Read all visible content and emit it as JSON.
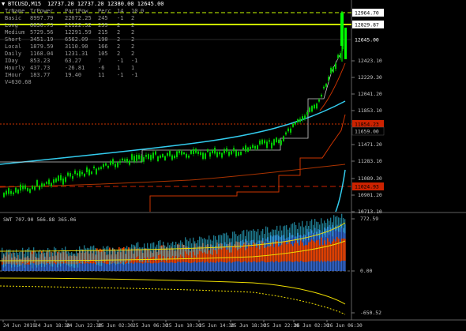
{
  "header": {
    "symbol": "BTCUSD,M15",
    "ohlc": "12737.20 12737.20 12380.00 12645.00"
  },
  "stats_table": {
    "headers": [
      "TrName",
      "TrPower",
      "PartPow",
      "Perc",
      "14",
      "10",
      "0"
    ],
    "rows": [
      [
        "Basic",
        "8997.79",
        "22072.25",
        "245",
        "-1",
        "2",
        ""
      ],
      [
        "Long",
        "8830.73",
        "21122.32",
        "239",
        "2",
        "2",
        ""
      ],
      [
        "Medium",
        "5729.56",
        "12291.59",
        "215",
        "2",
        "2",
        ""
      ],
      [
        "Short",
        "3451.19",
        "6562.09",
        "190",
        "2",
        "2",
        ""
      ],
      [
        "Local",
        "1879.59",
        "3110.90",
        "166",
        "2",
        "2",
        ""
      ],
      [
        "Daily",
        "1168.04",
        "1231.31",
        "105",
        "2",
        "2",
        ""
      ],
      [
        "IDay",
        "853.23",
        "63.27",
        "7",
        "-1",
        "-1",
        ""
      ],
      [
        "Hourly",
        "437.73",
        "-26.81",
        "-6",
        "1",
        "1",
        ""
      ],
      [
        "IHour",
        "183.77",
        "19.40",
        "11",
        "-1",
        "-1",
        ""
      ]
    ],
    "v_line": "V=630.68"
  },
  "price_axis": {
    "ticks": [
      "12423.10",
      "12229.30",
      "12041.20",
      "11853.10",
      "11471.20",
      "11283.10",
      "11089.30",
      "10901.20",
      "10713.10"
    ],
    "labels": [
      {
        "value": "12964.70",
        "color": "#ffffff",
        "text_color": "#000000"
      },
      {
        "value": "12829.87",
        "color": "#ffffff",
        "text_color": "#000000"
      },
      {
        "value": "12645.00",
        "color": "#000000",
        "text_color": "#ffffff"
      },
      {
        "value": "11854.23",
        "color": "#cc2200",
        "text_color": "#000000"
      },
      {
        "value": "11659.00",
        "color": "#000000",
        "text_color": "#c8c8c8"
      },
      {
        "value": "11024.93",
        "color": "#cc2200",
        "text_color": "#000000"
      }
    ]
  },
  "oscillator": {
    "title": "SWT 707.90 566.88 365.06",
    "ticks": [
      "772.59",
      "0.00",
      "-650.52"
    ]
  },
  "time_axis": {
    "labels": [
      "24 Jun 2019",
      "24 Jun 18:30",
      "24 Jun 22:30",
      "25 Jun 02:30",
      "25 Jun 06:30",
      "25 Jun 10:30",
      "25 Jun 14:30",
      "25 Jun 18:30",
      "25 Jun 22:30",
      "26 Jun 02:30",
      "26 Jun 06:30"
    ]
  },
  "colors": {
    "background": "#000000",
    "bull_candle": "#00cc00",
    "bear_candle": "#00cc00",
    "ma_cyan": "#33ccee",
    "ma_red": "#cc3300",
    "level_line": "#ccff00"
  }
}
